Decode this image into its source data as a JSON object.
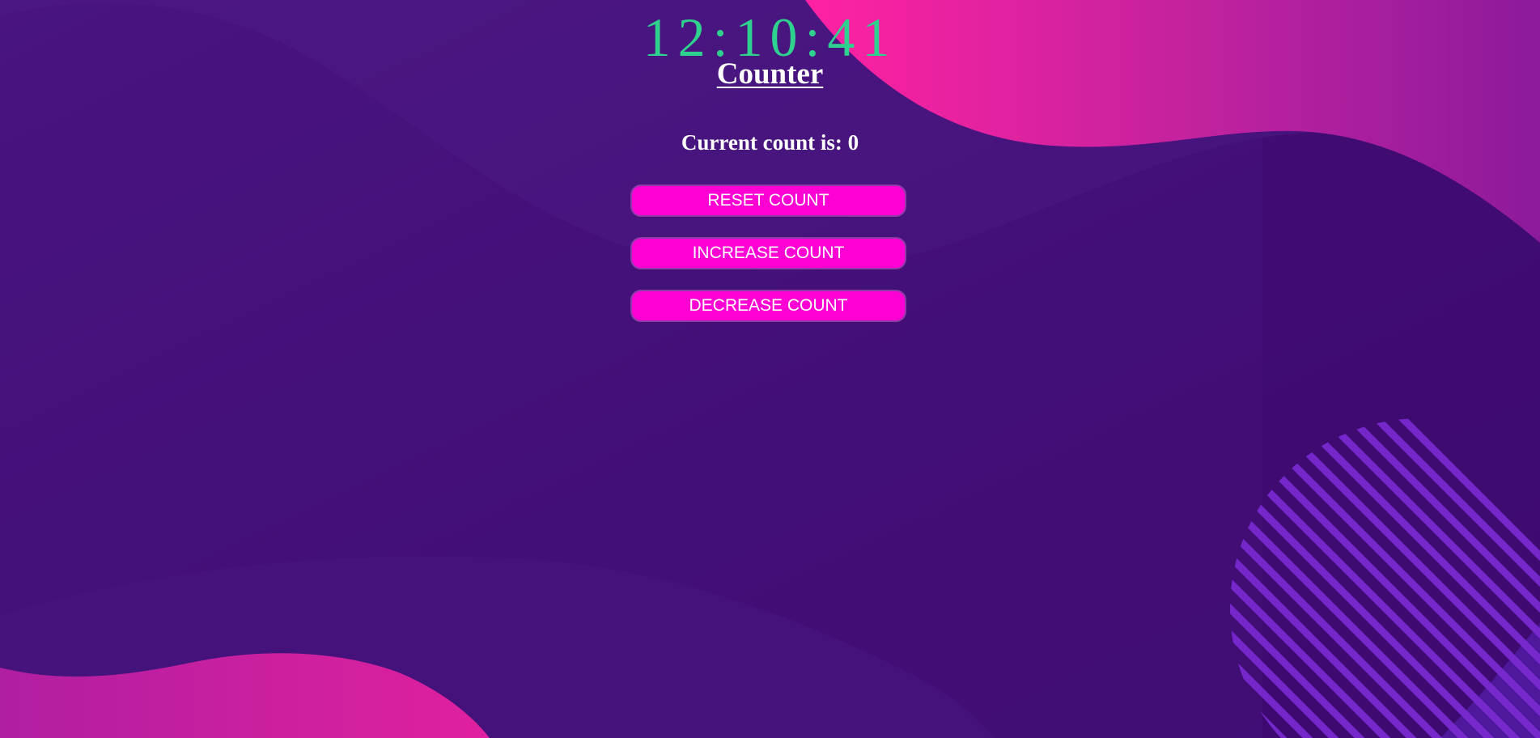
{
  "clock": {
    "time": "12:10:41",
    "color": "#2ed18d"
  },
  "counter": {
    "title": "Counter",
    "count_text": "Current count is: 0",
    "count_value": 0
  },
  "buttons": {
    "reset_label": "RESET COUNT",
    "increase_label": "INCREASE COUNT",
    "decrease_label": "DECREASE COUNT",
    "color": "#ff00d4"
  },
  "theme": {
    "background_base": "#3f0c74",
    "accent_pink": "#ff1fa6",
    "stripe_purple": "#7a2ad0"
  }
}
